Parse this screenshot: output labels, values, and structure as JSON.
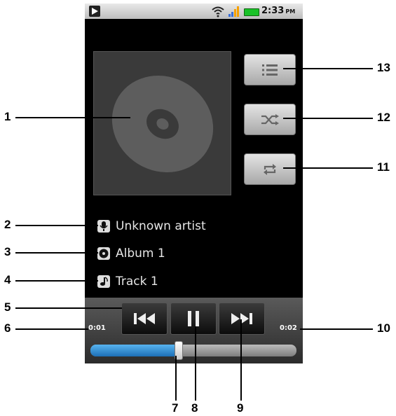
{
  "status_bar": {
    "time": "2:33",
    "ampm": "PM"
  },
  "track_info": {
    "artist": "Unknown artist",
    "album": "Album 1",
    "track": "Track 1"
  },
  "playback": {
    "elapsed": "0:01",
    "total": "0:02",
    "progress_fraction": 0.43
  },
  "callouts": {
    "c1": "1",
    "c2": "2",
    "c3": "3",
    "c4": "4",
    "c5": "5",
    "c6": "6",
    "c7": "7",
    "c8": "8",
    "c9": "9",
    "c10": "10",
    "c11": "11",
    "c12": "12",
    "c13": "13"
  },
  "colors": {
    "progress": "#2d86d2",
    "background": "#000000",
    "panel": "#3c3c3c"
  },
  "icons": {
    "status_play": "play-icon",
    "wifi": "wifi-icon",
    "signal": "signal-icon",
    "battery": "battery-icon",
    "album_art": "disc-icon",
    "playlist": "list-icon",
    "shuffle": "shuffle-icon",
    "repeat": "repeat-icon",
    "artist": "microphone-icon",
    "album": "disc-icon",
    "track": "music-note-icon",
    "previous": "previous-icon",
    "pause": "pause-icon",
    "next": "next-icon"
  }
}
